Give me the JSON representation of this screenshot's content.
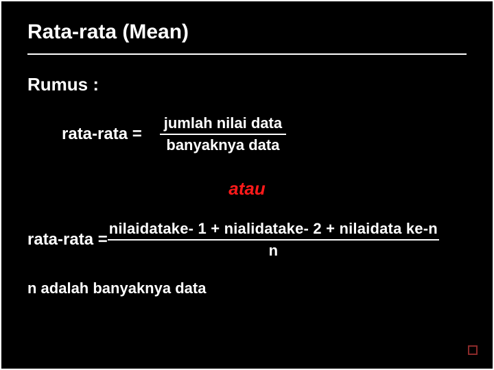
{
  "title": "Rata-rata (Mean)",
  "subtitle": "Rumus :",
  "formula1": {
    "lhs": "rata-rata =",
    "numerator": "jumlah nilai data",
    "denominator": "banyaknya data"
  },
  "or_label": "atau",
  "formula2": {
    "lhs": "rata-rata =",
    "numerator": "nilaidatake- 1 + nialidatake- 2 + nilaidata ke-n",
    "denominator": "n"
  },
  "note": "n adalah banyaknya data"
}
